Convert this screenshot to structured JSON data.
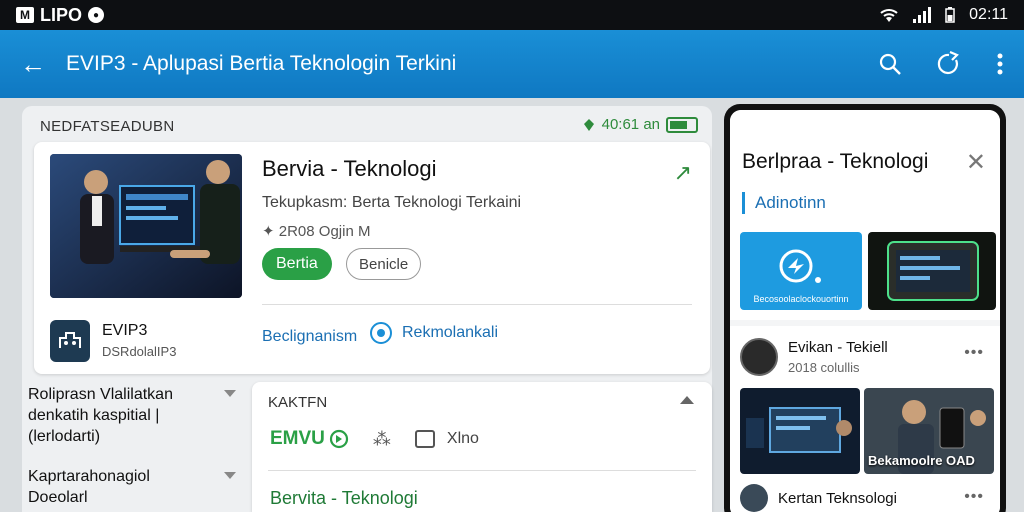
{
  "statusbar": {
    "brand": "LIPO",
    "brand_badge": "M",
    "time": "02:11"
  },
  "appbar": {
    "back_glyph": "←",
    "title": "EVIP3 - Aplupasi  Bertia Teknologin Terkini"
  },
  "left_panel": {
    "header": "NEDFATSEADUBN",
    "status_text": "40:61 an",
    "card": {
      "title": "Bervia - Teknologi",
      "subtitle": "Tekupkasm:  Berta Teknologi Terkaini",
      "meta": "2R08 Ogjin  M",
      "primary_button": "Bertia",
      "outline_button": "Benicle",
      "link1": "Beclignanism",
      "link2": "Rekmolankali"
    },
    "app": {
      "name": "EVIP3",
      "sub": "DSRdolalIP3"
    },
    "expand1": [
      "Roliprasn Vlalilatkan",
      "denkatih kaspitial  |",
      "(lerlodarti)"
    ],
    "expand2": [
      "Kaprtarahonagiol",
      "Doeolarl"
    ]
  },
  "card2": {
    "header": "KAKTFN",
    "green_label": "EMVU",
    "chat_label": "Xlno",
    "footer_title": "Bervita - Teknologi"
  },
  "right_panel": {
    "title": "Berlpraa - Teknologi",
    "close_glyph": "✕",
    "tab": "Adinotinn",
    "tile1_label": "Becosoolaclockouortinn",
    "item1": {
      "name": "Evikan - Tekiell",
      "sub": "2018 colullis"
    },
    "more_glyph": "•••",
    "img2_caption": "Bekamoolre OAD",
    "item2": {
      "name": "Kertan Teknsologi"
    }
  },
  "colors": {
    "appbar": "#1a8fd6",
    "accent_green": "#2aa046",
    "link_blue": "#1b6fb3"
  }
}
